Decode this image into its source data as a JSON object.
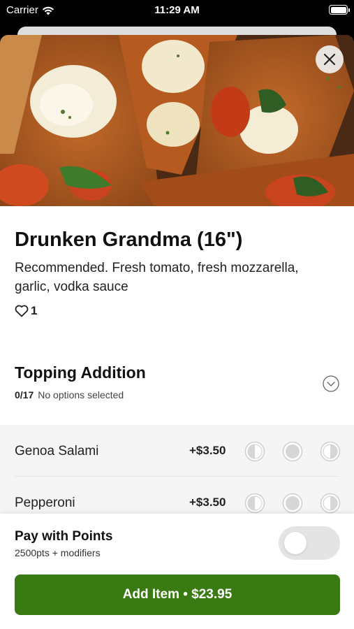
{
  "status_bar": {
    "carrier": "Carrier",
    "time": "11:29 AM"
  },
  "item": {
    "title": "Drunken Grandma (16\")",
    "description": "Recommended. Fresh tomato, fresh mozzarella, garlic, vodka sauce",
    "likes": "1"
  },
  "section": {
    "title": "Topping Addition",
    "count": "0/17",
    "status": "No options selected"
  },
  "options": [
    {
      "name": "Genoa Salami",
      "price": "+$3.50"
    },
    {
      "name": "Pepperoni",
      "price": "+$3.50"
    }
  ],
  "points": {
    "title": "Pay with Points",
    "subtitle": "2500pts + modifiers",
    "enabled": false
  },
  "add_button": {
    "label": "Add Item • $23.95"
  },
  "colors": {
    "accent": "#3a7a12",
    "toggle_off": "#e4e4e4"
  },
  "icons": [
    "wifi-icon",
    "battery-icon",
    "close-icon",
    "heart-icon",
    "chevron-down-icon",
    "left-half-icon",
    "whole-icon",
    "right-half-icon"
  ]
}
